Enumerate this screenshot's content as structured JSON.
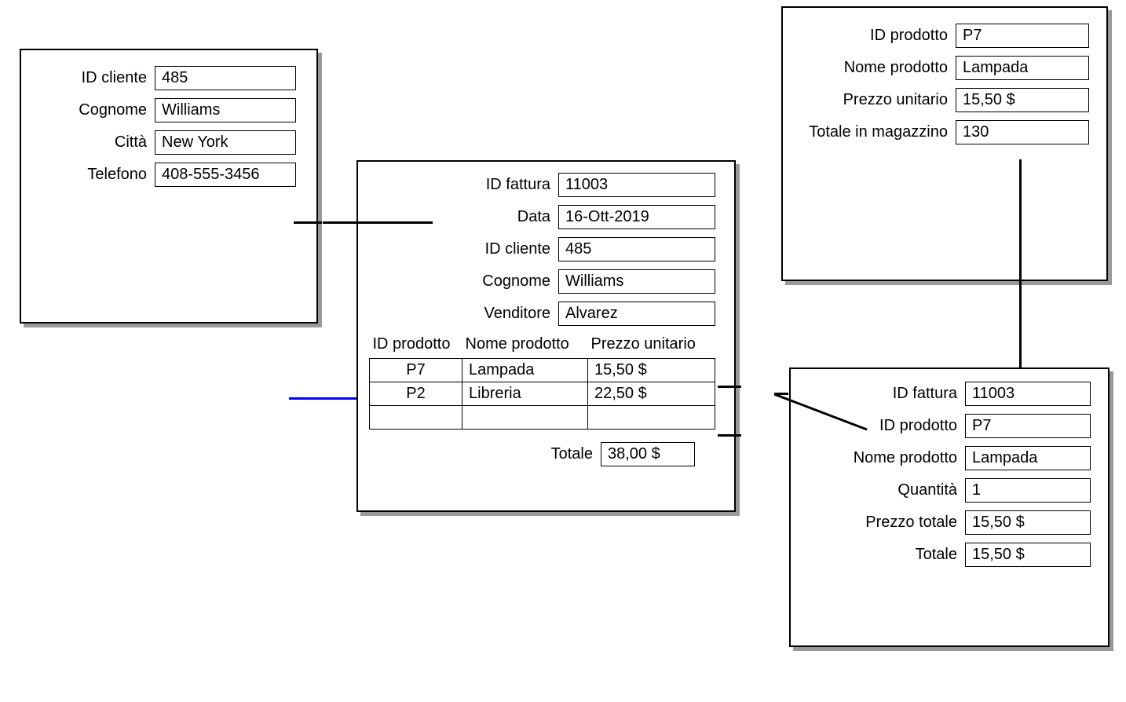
{
  "client": {
    "labels": {
      "id": "ID cliente",
      "surname": "Cognome",
      "city": "Città",
      "phone": "Telefono"
    },
    "values": {
      "id": "485",
      "surname": "Williams",
      "city": "New York",
      "phone": "408-555-3456"
    }
  },
  "invoice": {
    "labels": {
      "id": "ID fattura",
      "date": "Data",
      "client_id": "ID cliente",
      "surname": "Cognome",
      "seller": "Venditore",
      "total": "Totale"
    },
    "values": {
      "id": "11003",
      "date": "16-Ott-2019",
      "client_id": "485",
      "surname": "Williams",
      "seller": "Alvarez",
      "total": "38,00 $"
    },
    "table": {
      "headers": {
        "product_id": "ID prodotto",
        "product_name": "Nome prodotto",
        "unit_price": "Prezzo unitario"
      },
      "rows": [
        {
          "product_id": "P7",
          "product_name": "Lampada",
          "unit_price": "15,50 $"
        },
        {
          "product_id": "P2",
          "product_name": "Libreria",
          "unit_price": "22,50 $"
        },
        {
          "product_id": "",
          "product_name": "",
          "unit_price": ""
        }
      ]
    }
  },
  "product": {
    "labels": {
      "id": "ID prodotto",
      "name": "Nome prodotto",
      "unit_price": "Prezzo unitario",
      "stock": "Totale in magazzino"
    },
    "values": {
      "id": "P7",
      "name": "Lampada",
      "unit_price": "15,50 $",
      "stock": "130"
    }
  },
  "line_item": {
    "labels": {
      "invoice_id": "ID fattura",
      "product_id": "ID prodotto",
      "product_name": "Nome prodotto",
      "quantity": "Quantità",
      "total_price": "Prezzo totale",
      "total": "Totale"
    },
    "values": {
      "invoice_id": "11003",
      "product_id": "P7",
      "product_name": "Lampada",
      "quantity": "1",
      "total_price": "15,50 $",
      "total": "15,50 $"
    }
  }
}
